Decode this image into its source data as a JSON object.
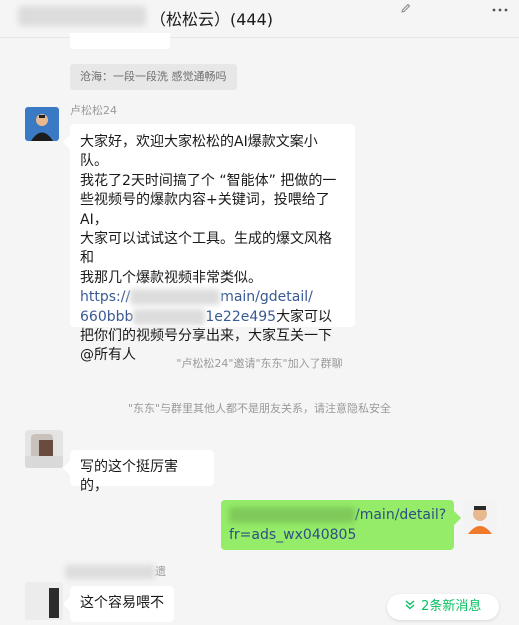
{
  "header": {
    "title": "（松松云）(444)",
    "edit_icon": "pencil-icon",
    "more_icon": "more-dots-icon"
  },
  "messages": {
    "quote_text": "沧海：一段一段洗  感觉通畅吗",
    "lu_sender": "卢松松24",
    "lu_message": {
      "line1": "大家好，欢迎大家松松的AI爆款文案小队。",
      "line2": "我花了2天时间搞了个 “智能体” 把做的一",
      "line3": "些视频号的爆款内容+关键词，投喂给了",
      "line4": "AI，",
      "line5": "大家可以试试这个工具。生成的爆文风格和",
      "line6": "我那几个爆款视频非常类似。",
      "link_start": "https://",
      "link_mid": "main/gdetail/",
      "link_2a": "660bbb",
      "link_2b": "1e22e495",
      "line_after_link": "大家可以",
      "line8": "把你们的视频号分享出来，大家互关一下",
      "line9": "@所有人"
    },
    "system_invite": "\"卢松松24\"邀请\"东东\"加入了群聊",
    "system_privacy": "\"东东\"与群里其他人都不是朋友关系，请注意隐私安全",
    "dongdong_message": "写的这个挺厉害的，",
    "my_message": {
      "line1_tail": "/main/detail?",
      "line2": "fr=ads_wx040805"
    },
    "last_message": "这个容易喂不",
    "last_sender_tail": "遗"
  },
  "new_messages": {
    "label": "2条新消息",
    "icon": "double-chevron-down-icon"
  },
  "colors": {
    "background": "#f5f5f5",
    "my_bubble": "#95ec69",
    "other_bubble": "#ffffff",
    "link": "#3a5a93",
    "new_msg_text": "#07c160"
  }
}
